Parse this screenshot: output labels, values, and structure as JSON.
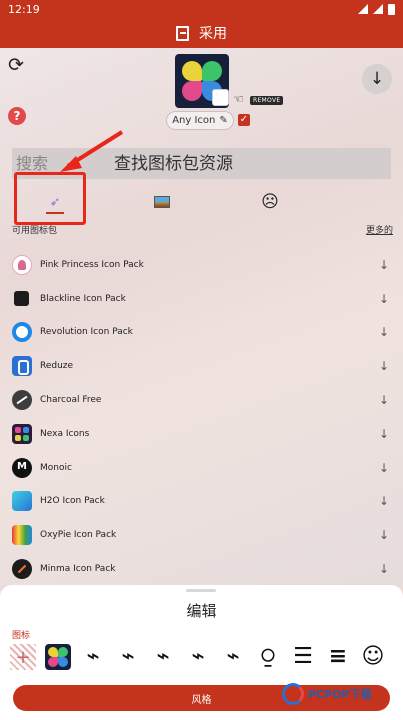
{
  "status_bar": {
    "time": "12:19"
  },
  "app_bar": {
    "title": "采用"
  },
  "preview": {
    "icon_name": "clover-icon",
    "remove_label": "REMOVE",
    "chip_label": "Any Icon"
  },
  "search": {
    "placeholder": "搜索",
    "caption": "查找图标包资源"
  },
  "section": {
    "title": "可用图标包",
    "more_label": "更多的"
  },
  "packs": [
    {
      "name": "Pink Princess Icon Pack"
    },
    {
      "name": "Blackline Icon Pack"
    },
    {
      "name": "Revolution Icon Pack"
    },
    {
      "name": "Reduze"
    },
    {
      "name": "Charcoal Free"
    },
    {
      "name": "Nexa Icons"
    },
    {
      "name": "Monoic"
    },
    {
      "name": "H2O Icon Pack"
    },
    {
      "name": "OxyPie Icon Pack"
    },
    {
      "name": "Minma Icon Pack"
    }
  ],
  "sheet": {
    "title": "编辑",
    "icons_label": "图标",
    "style_button": "风格"
  },
  "watermark": {
    "text": "PCPOP下载"
  },
  "colors": {
    "accent": "#c4331c",
    "highlight": "#e8271a"
  }
}
